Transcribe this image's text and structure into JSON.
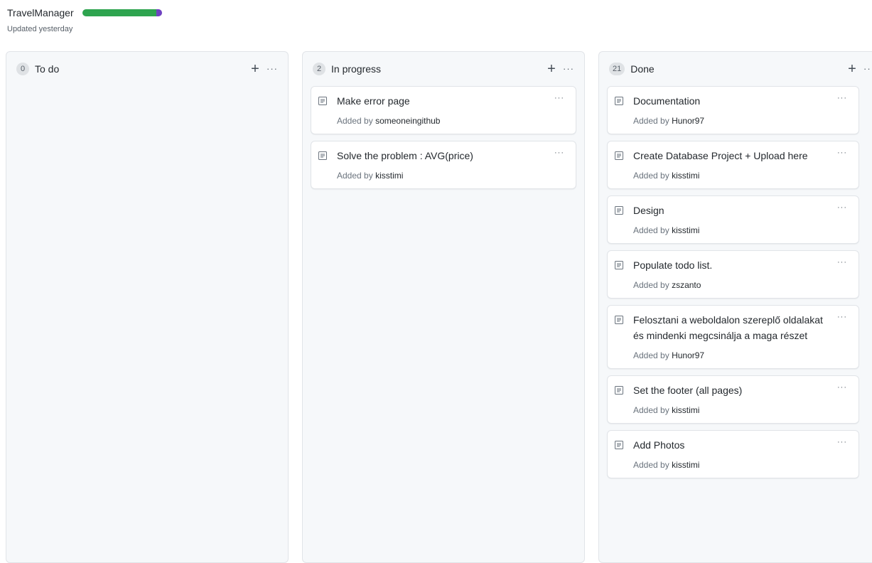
{
  "project": {
    "title": "TravelManager",
    "updated": "Updated yesterday",
    "progress": {
      "done_fraction": 0.93,
      "in_progress_fraction": 0.07,
      "done_color": "#2ea44f",
      "in_progress_color": "#6f42c1"
    }
  },
  "columns": [
    {
      "count": "0",
      "name": "To do",
      "cards": []
    },
    {
      "count": "2",
      "name": "In progress",
      "cards": [
        {
          "title": "Make error page",
          "added_prefix": "Added by",
          "user": "someoneingithub"
        },
        {
          "title": "Solve the problem : AVG(price)",
          "added_prefix": "Added by",
          "user": "kisstimi"
        }
      ]
    },
    {
      "count": "21",
      "name": "Done",
      "cards": [
        {
          "title": "Documentation",
          "added_prefix": "Added by",
          "user": "Hunor97"
        },
        {
          "title": "Create Database Project + Upload here",
          "added_prefix": "Added by",
          "user": "kisstimi"
        },
        {
          "title": "Design",
          "added_prefix": "Added by",
          "user": "kisstimi"
        },
        {
          "title": "Populate todo list.",
          "added_prefix": "Added by",
          "user": "zszanto"
        },
        {
          "title": "Felosztani a weboldalon szereplő oldalakat és mindenki megcsinálja a maga részet",
          "added_prefix": "Added by",
          "user": "Hunor97"
        },
        {
          "title": "Set the footer (all pages)",
          "added_prefix": "Added by",
          "user": "kisstimi"
        },
        {
          "title": "Add Photos",
          "added_prefix": "Added by",
          "user": "kisstimi"
        }
      ]
    }
  ],
  "icons": {
    "add": "plus-icon",
    "more": "kebab-icon",
    "note": "note-icon"
  },
  "glyphs": {
    "plus": "+",
    "dots": "···"
  }
}
